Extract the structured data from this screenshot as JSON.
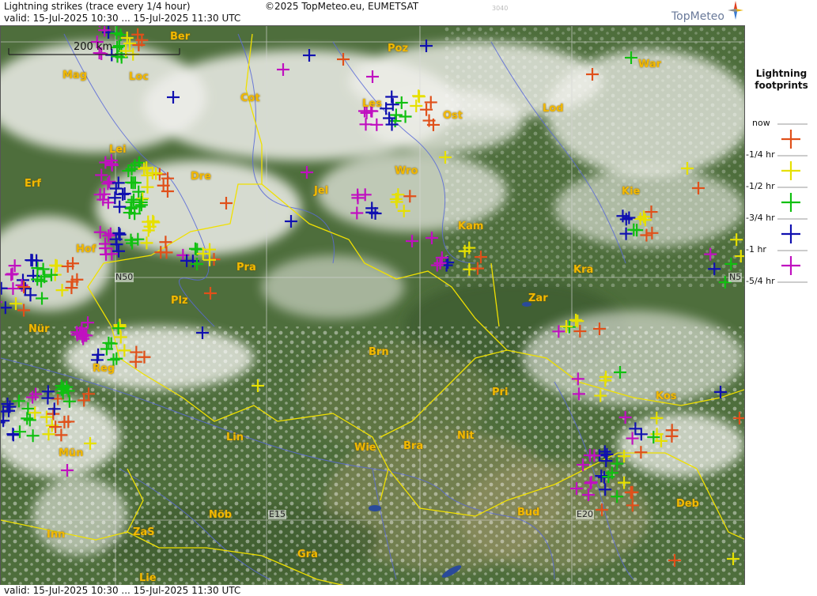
{
  "header": {
    "title": "Lightning strikes (trace every 1/4 hour)",
    "valid": "valid:  15-Jul-2025 10:30 ... 15-Jul-2025 11:30 UTC",
    "copyright": "©2025 TopMeteo.eu, EUMETSAT",
    "code": "3040",
    "brand": "TopMeteo"
  },
  "footer": {
    "valid": "valid:  15-Jul-2025 10:30 ... 15-Jul-2025 11:30 UTC"
  },
  "scale": {
    "label": "200 km"
  },
  "grid_labels": {
    "n50_left": "N50",
    "n50_right": "N5",
    "e15": "E15",
    "e20": "E20"
  },
  "cities": {
    "ber": "Ber",
    "mag": "Mag",
    "loc": "Loc",
    "cot": "Cot",
    "poz": "Poz",
    "war": "War",
    "les": "Les",
    "ost": "Ost",
    "lod": "Lod",
    "lei": "Lei",
    "erf": "Erf",
    "dre": "Dre",
    "wro": "Wro",
    "jel": "Jel",
    "kie": "Kie",
    "kam": "Kam",
    "hof": "Hof",
    "pra": "Pra",
    "kra": "Kra",
    "plz": "Plz",
    "zar": "Zar",
    "nur": "Nür",
    "brn": "Brn",
    "reg": "Reg",
    "pri": "Pri",
    "kos": "Kos",
    "lin": "Lin",
    "nit": "Nit",
    "wie": "Wie",
    "bra": "Bra",
    "mun": "Mün",
    "bud": "Bud",
    "deb": "Deb",
    "nob": "Nöb",
    "inn": "Inn",
    "zas": "ZaS",
    "gra": "Gra",
    "lie": "Lie"
  },
  "legend": {
    "title_line1": "Lightning",
    "title_line2": "footprints",
    "entries": [
      {
        "label": "now",
        "color": "#e0501a"
      },
      {
        "label": "-1/4 hr",
        "color": "#e6e000"
      },
      {
        "label": "-1/2 hr",
        "color": "#10c010"
      },
      {
        "label": "-3/4 hr",
        "color": "#1010b0"
      },
      {
        "label": "-1 hr",
        "color": "#c010c0"
      },
      {
        "label": "-5/4 hr",
        "color": "#000000"
      }
    ]
  },
  "colors": {
    "land": "#4a6b3a",
    "cloud": "#f2f2ee",
    "border": "#f0e000",
    "river": "#5a6ad8"
  }
}
